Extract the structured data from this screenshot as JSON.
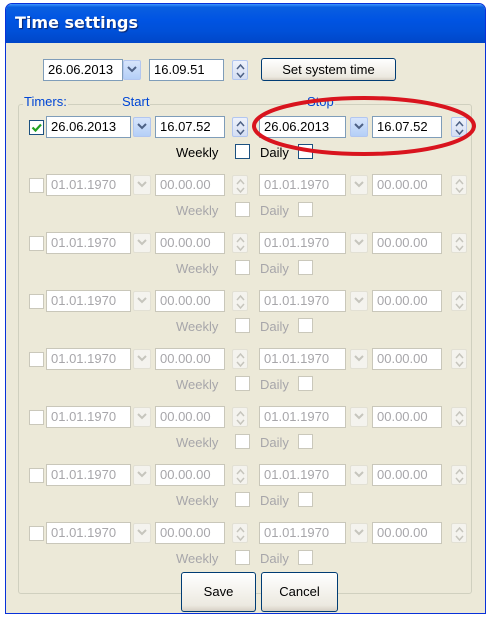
{
  "window": {
    "title": "Time settings"
  },
  "system": {
    "date": "26.06.2013",
    "time": "16.09.51",
    "set_button": "Set system time"
  },
  "timers": {
    "group_label": "Timers:",
    "start_label": "Start",
    "stop_label": "Stop",
    "weekly_label": "Weekly",
    "daily_label": "Daily",
    "rows": [
      {
        "checked": true,
        "enabled": true,
        "start_date": "26.06.2013",
        "start_time": "16.07.52",
        "stop_date": "26.06.2013",
        "stop_time": "16.07.52"
      },
      {
        "checked": false,
        "enabled": false,
        "start_date": "01.01.1970",
        "start_time": "00.00.00",
        "stop_date": "01.01.1970",
        "stop_time": "00.00.00"
      },
      {
        "checked": false,
        "enabled": false,
        "start_date": "01.01.1970",
        "start_time": "00.00.00",
        "stop_date": "01.01.1970",
        "stop_time": "00.00.00"
      },
      {
        "checked": false,
        "enabled": false,
        "start_date": "01.01.1970",
        "start_time": "00.00.00",
        "stop_date": "01.01.1970",
        "stop_time": "00.00.00"
      },
      {
        "checked": false,
        "enabled": false,
        "start_date": "01.01.1970",
        "start_time": "00.00.00",
        "stop_date": "01.01.1970",
        "stop_time": "00.00.00"
      },
      {
        "checked": false,
        "enabled": false,
        "start_date": "01.01.1970",
        "start_time": "00.00.00",
        "stop_date": "01.01.1970",
        "stop_time": "00.00.00"
      },
      {
        "checked": false,
        "enabled": false,
        "start_date": "01.01.1970",
        "start_time": "00.00.00",
        "stop_date": "01.01.1970",
        "stop_time": "00.00.00"
      },
      {
        "checked": false,
        "enabled": false,
        "start_date": "01.01.1970",
        "start_time": "00.00.00",
        "stop_date": "01.01.1970",
        "stop_time": "00.00.00"
      }
    ]
  },
  "buttons": {
    "save": "Save",
    "cancel": "Cancel"
  },
  "colors": {
    "highlight_ellipse": "#d9141e",
    "title_bar": "#0054e3",
    "group_label": "#0046d5"
  }
}
